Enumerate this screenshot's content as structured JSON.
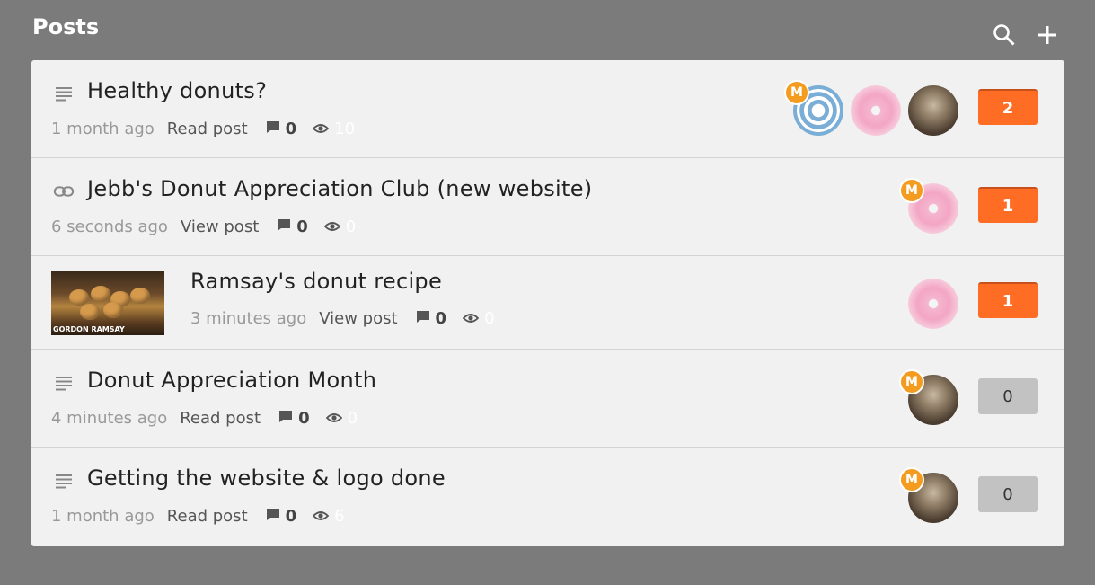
{
  "header": {
    "title": "Posts",
    "search_icon": "search-icon",
    "add_icon": "plus-icon"
  },
  "posts": [
    {
      "type": "text",
      "title": "Healthy donuts?",
      "time": "1 month ago",
      "action": "Read post",
      "comments": "0",
      "views": "10",
      "avatars": [
        "swirl",
        "donut",
        "portrait"
      ],
      "moderator_badge": "M",
      "votes": "2",
      "vote_style": "hot"
    },
    {
      "type": "link",
      "title": "Jebb's Donut Appreciation Club (new website)",
      "time": "6 seconds ago",
      "action": "View post",
      "comments": "0",
      "views": "0",
      "avatars": [
        "donut"
      ],
      "moderator_badge": "M",
      "votes": "1",
      "vote_style": "hot"
    },
    {
      "type": "image",
      "title": "Ramsay's donut recipe",
      "time": "3 minutes ago",
      "action": "View post",
      "comments": "0",
      "views": "0",
      "avatars": [
        "donut"
      ],
      "moderator_badge": "",
      "votes": "1",
      "vote_style": "hot",
      "thumbnail_caption": "GORDON RAMSAY"
    },
    {
      "type": "text",
      "title": "Donut Appreciation Month",
      "time": "4 minutes ago",
      "action": "Read post",
      "comments": "0",
      "views": "0",
      "avatars": [
        "portrait"
      ],
      "moderator_badge": "M",
      "votes": "0",
      "vote_style": "cold"
    },
    {
      "type": "text",
      "title": "Getting the website & logo done",
      "time": "1 month ago",
      "action": "Read post",
      "comments": "0",
      "views": "6",
      "avatars": [
        "portrait"
      ],
      "moderator_badge": "M",
      "votes": "0",
      "vote_style": "cold"
    }
  ],
  "colors": {
    "background": "#7b7b7b",
    "panel": "#f1f1f1",
    "vote_hot": "#ff6d24",
    "vote_cold": "#c2c2c2",
    "moderator": "#f39c1f"
  }
}
